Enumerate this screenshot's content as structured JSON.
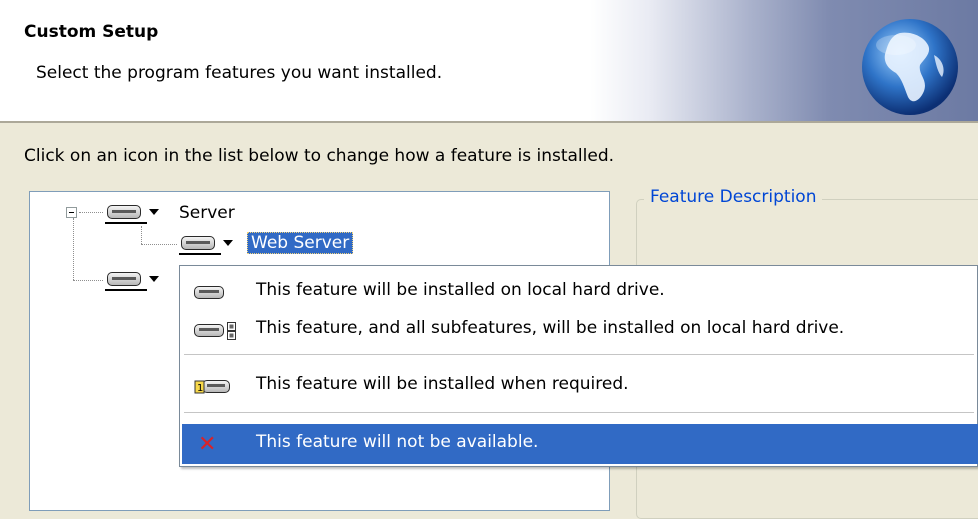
{
  "header": {
    "title": "Custom Setup",
    "subtitle": "Select the program features you want installed."
  },
  "instruction": "Click on an icon in the list below to change how a feature is installed.",
  "tree": {
    "items": [
      {
        "label": "Server",
        "level": 0,
        "expanded": true
      },
      {
        "label": "Web Server",
        "level": 1,
        "selected": true
      },
      {
        "label": "",
        "level": 0
      }
    ]
  },
  "description": {
    "title": "Feature Description"
  },
  "menu": {
    "items": [
      {
        "icon": "hard-drive-icon",
        "label": "This feature will be installed on local hard drive."
      },
      {
        "icon": "hard-drive-subfeatures-icon",
        "label": "This feature, and all subfeatures, will be installed on local hard drive."
      },
      {
        "icon": "install-on-demand-icon",
        "label": "This feature will be installed when required."
      },
      {
        "icon": "not-available-x-icon",
        "label": "This feature will not be available.",
        "highlighted": true
      }
    ]
  },
  "colors": {
    "selection": "#316ac5",
    "group_title": "#0046d5",
    "dialog_bg": "#ece9d8",
    "x_mark": "#d8232a"
  }
}
